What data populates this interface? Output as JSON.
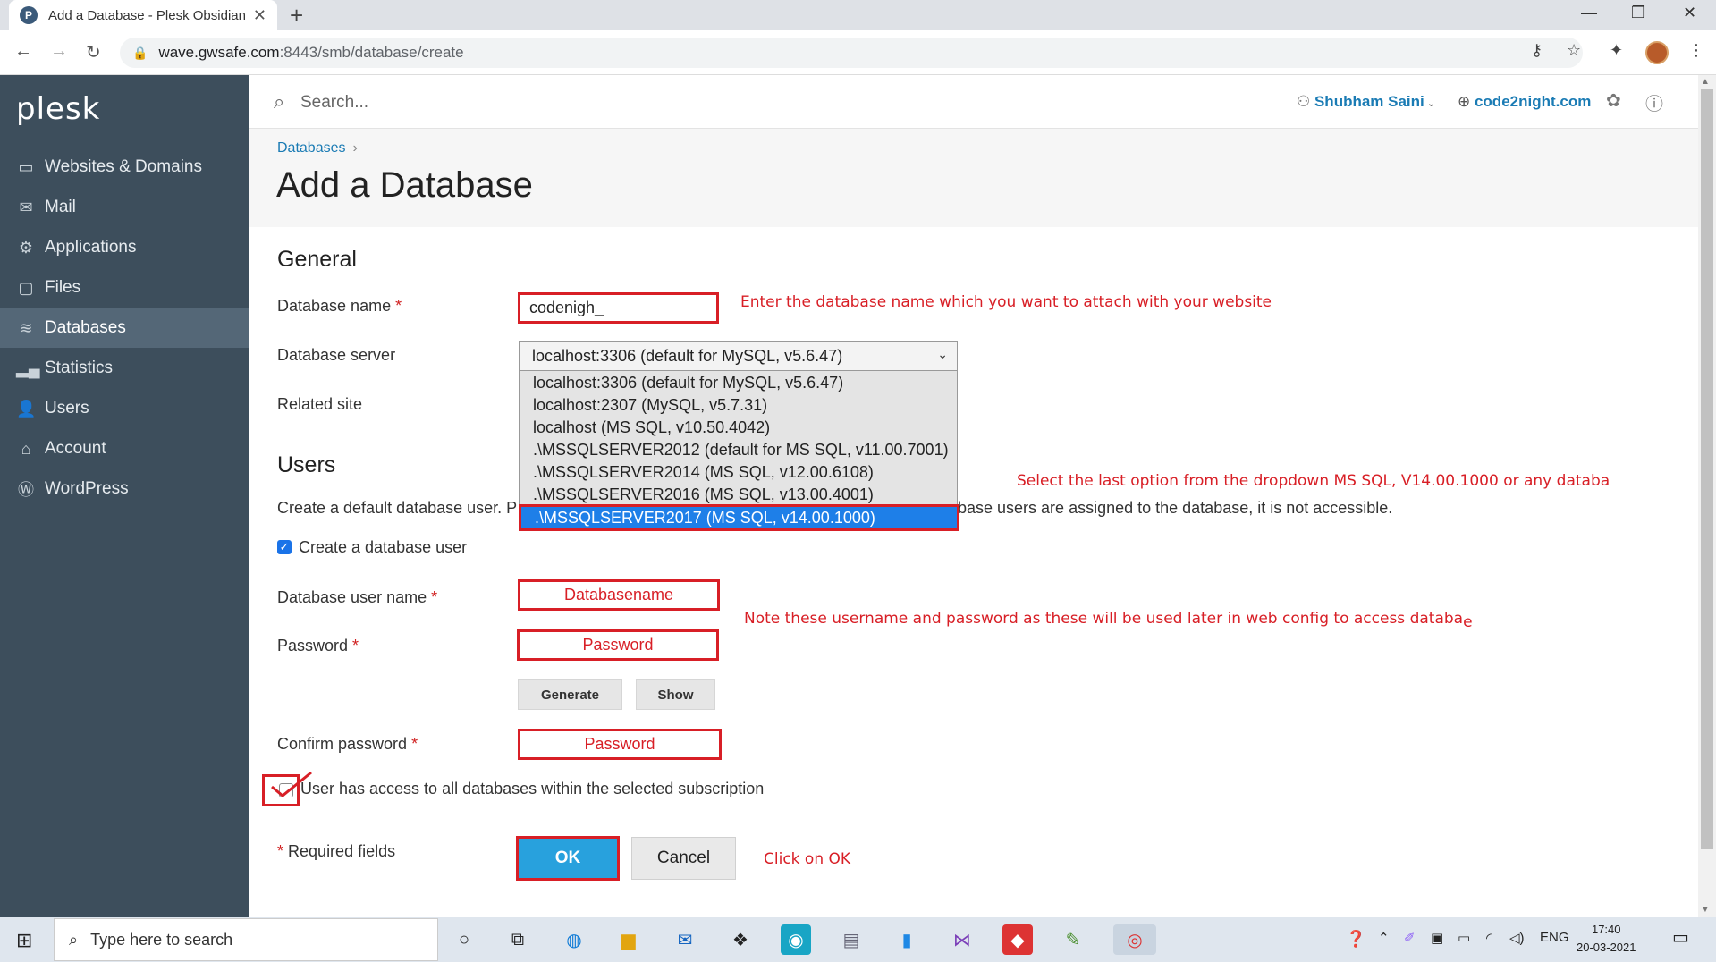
{
  "browser": {
    "tab_title": "Add a Database - Plesk Obsidian",
    "url_host": "wave.gwsafe.com",
    "url_path": ":8443/smb/database/create"
  },
  "sidebar": {
    "logo": "plesk",
    "items": [
      {
        "label": "Websites & Domains",
        "icon": "monitor-icon"
      },
      {
        "label": "Mail",
        "icon": "envelope-icon"
      },
      {
        "label": "Applications",
        "icon": "gear-icon"
      },
      {
        "label": "Files",
        "icon": "folder-icon"
      },
      {
        "label": "Databases",
        "icon": "database-icon"
      },
      {
        "label": "Statistics",
        "icon": "bar-chart-icon"
      },
      {
        "label": "Users",
        "icon": "user-icon"
      },
      {
        "label": "Account",
        "icon": "briefcase-icon"
      },
      {
        "label": "WordPress",
        "icon": "wordpress-icon"
      }
    ],
    "active": "Databases"
  },
  "header": {
    "search_placeholder": "Search...",
    "user": "Shubham Saini",
    "domain": "code2night.com"
  },
  "breadcrumb": "Databases",
  "page_title": "Add a Database",
  "general": {
    "heading": "General",
    "db_name_label": "Database name",
    "db_name_value": "codenigh_",
    "db_server_label": "Database server",
    "db_server_value": "localhost:3306 (default for MySQL, v5.6.47)",
    "related_site_label": "Related site",
    "server_options": [
      "localhost:3306 (default for MySQL, v5.6.47)",
      "localhost:2307 (MySQL, v5.7.31)",
      "localhost (MS SQL, v10.50.4042)",
      ".\\MSSQLSERVER2012 (default for MS SQL, v11.00.7001)",
      ".\\MSSQLSERVER2014 (MS SQL, v12.00.6108)",
      ".\\MSSQLSERVER2016 (MS SQL, v13.00.4001)",
      ".\\MSSQLSERVER2017 (MS SQL, v14.00.1000)"
    ],
    "selected_option_index": 6
  },
  "users": {
    "heading": "Users",
    "desc_left": "Create a default database user. P",
    "desc_right": "base users are assigned to the database, it is not accessible.",
    "create_user_label": "Create a database user",
    "username_label": "Database user name",
    "username_placeholder": "Databasename",
    "password_label": "Password",
    "password_placeholder": "Password",
    "generate_label": "Generate",
    "show_label": "Show",
    "confirm_label": "Confirm password",
    "confirm_placeholder": "Password",
    "access_all_label": "User has access to all databases within the selected subscription"
  },
  "required_note": "Required fields",
  "ok_label": "OK",
  "cancel_label": "Cancel",
  "annotations": {
    "db_name": "Enter the database name which you want to attach with your website",
    "select_server": "Select the last option from the dropdown MS SQL, V14.00.1000 or any databa",
    "credentials": "Note these username and password as these will be used later in web config to access databa",
    "credentials_tail": "e",
    "ok": "Click on OK"
  },
  "taskbar": {
    "search_placeholder": "Type here to search",
    "language": "ENG",
    "time": "17:40",
    "date": "20-03-2021"
  }
}
